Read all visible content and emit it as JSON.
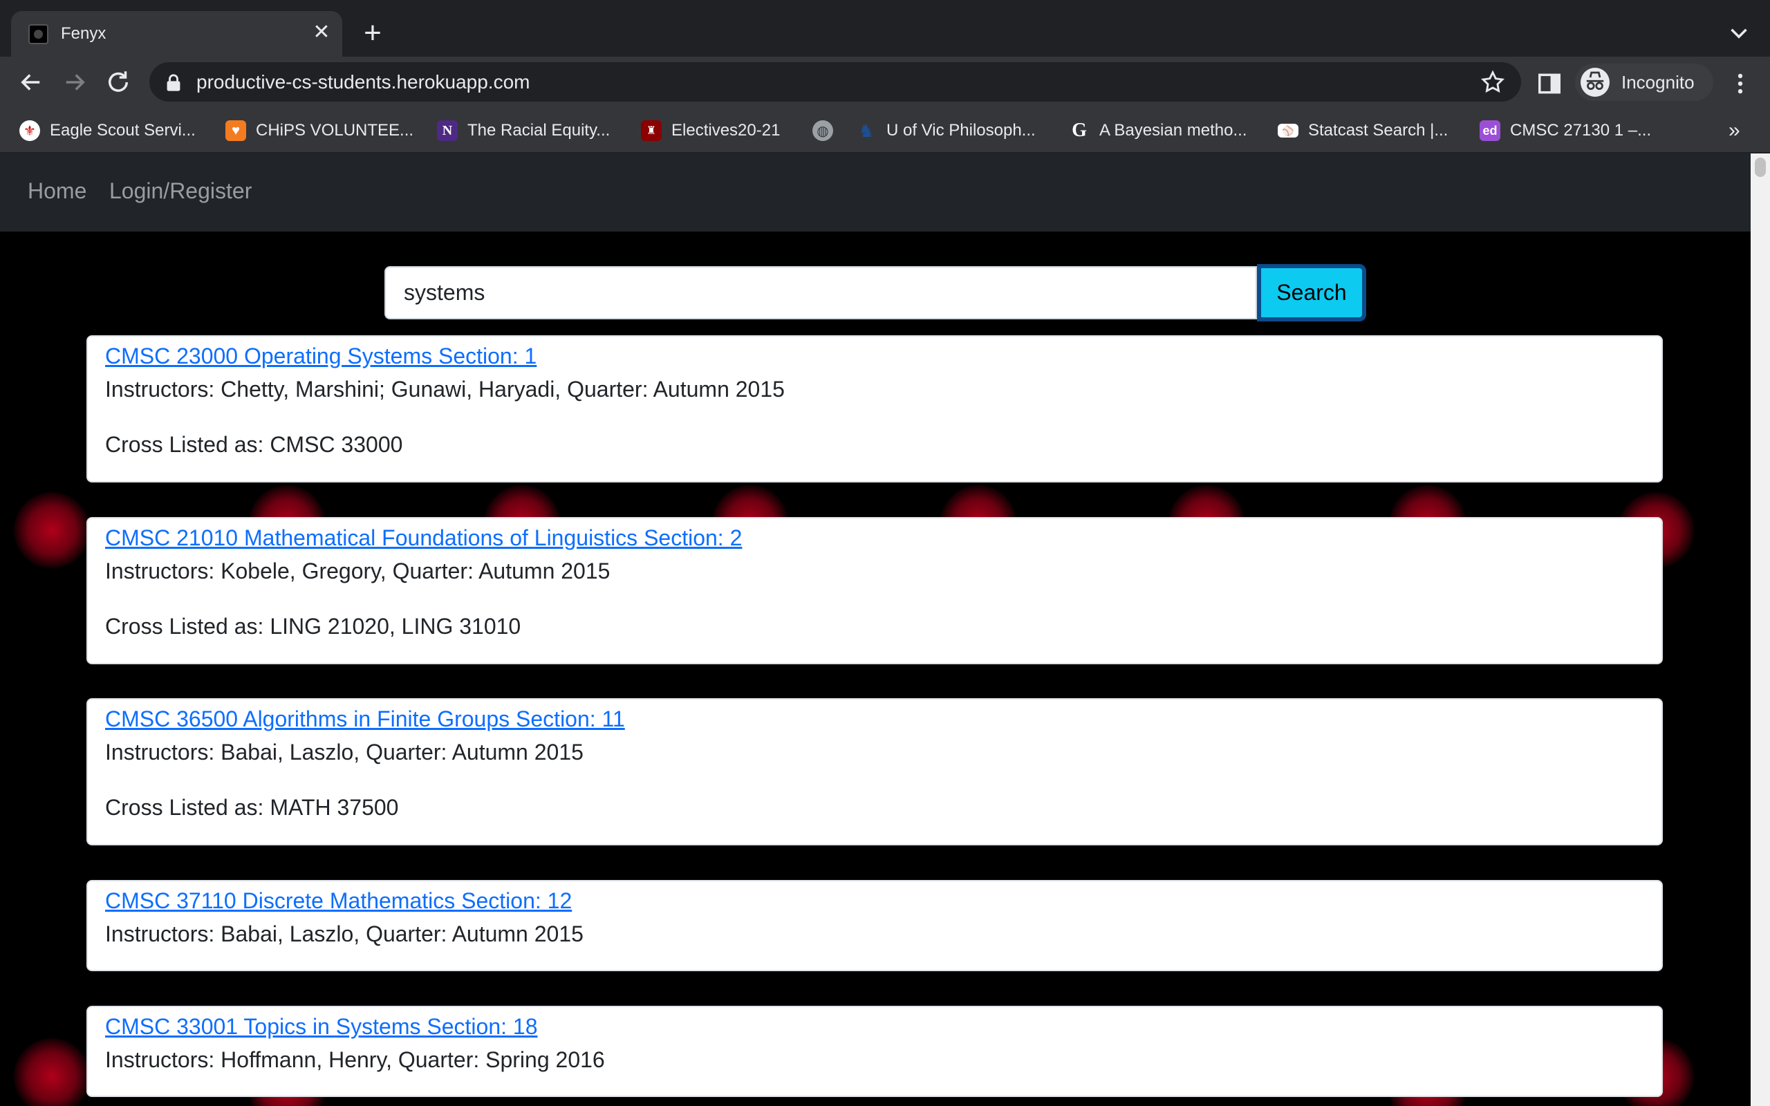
{
  "browser": {
    "tab_title": "Fenyx",
    "url": "productive-cs-students.herokuapp.com",
    "profile_label": "Incognito",
    "bookmarks": [
      {
        "label": "Eagle Scout Servi...",
        "icon": "scout-icon",
        "color": "#ffffff"
      },
      {
        "label": "CHiPS VOLUNTEE...",
        "icon": "heart-icon",
        "color": "#f47c20"
      },
      {
        "label": "The Racial Equity...",
        "icon": "N",
        "color": "#4e2a84"
      },
      {
        "label": "Electives20-21",
        "icon": "crest-icon",
        "color": "#8b0000"
      },
      {
        "label": "",
        "icon": "globe-icon",
        "color": "#9aa0a6"
      },
      {
        "label": "U of Vic Philosoph...",
        "icon": "uvic-icon",
        "color": "#1e4f91"
      },
      {
        "label": "A Bayesian metho...",
        "icon": "G",
        "color": "#ffffff"
      },
      {
        "label": "Statcast Search |...",
        "icon": "mlb-icon",
        "color": "#1a73e8"
      },
      {
        "label": "CMSC 27130 1 –...",
        "icon": "ed",
        "color": "#9b4fd6"
      }
    ]
  },
  "nav": {
    "home": "Home",
    "login": "Login/Register"
  },
  "search": {
    "value": "systems",
    "button": "Search"
  },
  "results": [
    {
      "title": "CMSC 23000 Operating Systems Section: 1",
      "instructors": "Instructors: Chetty, Marshini; Gunawi, Haryadi, Quarter: Autumn 2015",
      "cross_listed": "Cross Listed as: CMSC 33000"
    },
    {
      "title": "CMSC 21010 Mathematical Foundations of Linguistics Section: 2",
      "instructors": "Instructors: Kobele, Gregory, Quarter: Autumn 2015",
      "cross_listed": "Cross Listed as: LING 21020, LING 31010"
    },
    {
      "title": "CMSC 36500 Algorithms in Finite Groups Section: 11",
      "instructors": "Instructors: Babai, Laszlo, Quarter: Autumn 2015",
      "cross_listed": "Cross Listed as: MATH 37500"
    },
    {
      "title": "CMSC 37110 Discrete Mathematics Section: 12",
      "instructors": "Instructors: Babai, Laszlo, Quarter: Autumn 2015",
      "cross_listed": ""
    },
    {
      "title": "CMSC 33001 Topics in Systems Section: 18",
      "instructors": "Instructors: Hoffmann, Henry, Quarter: Spring 2016",
      "cross_listed": ""
    }
  ]
}
